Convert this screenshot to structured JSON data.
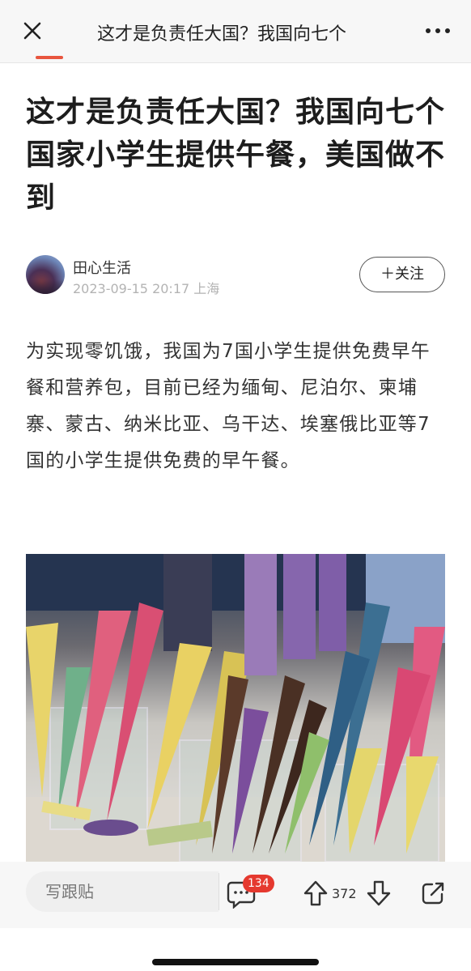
{
  "topbar": {
    "title": "这才是负责任大国？我国向七个",
    "close_icon": "close-icon",
    "more_icon": "more-dots-icon"
  },
  "article": {
    "headline": "这才是负责任大国？我国向七个国家小学生提供午餐，美国做不到",
    "author_name": "田心生活",
    "author_meta": "2023-09-15 20:17 上海",
    "follow_label": "＋关注",
    "body": "为实现零饥饿，我国为7国小学生提供免费早午餐和营养包，目前已经为缅甸、尼泊尔、柬埔寨、蒙古、纳米比亚、乌干达、埃塞俄比亚等7国的小学生提供免费的早午餐。",
    "photo_icon": "ice-cream-cones-photo"
  },
  "bottombar": {
    "comment_placeholder": "写跟贴",
    "comment_count": "134",
    "vote_count": "372",
    "comment_icon": "comment-icon",
    "upvote_icon": "upvote-arrow-icon",
    "downvote_icon": "downvote-arrow-icon",
    "share_icon": "share-icon"
  },
  "colors": {
    "accent": "#e5392f",
    "topbar_bg": "#f7f7f7",
    "text": "#222222",
    "meta": "#b3b3b3"
  }
}
